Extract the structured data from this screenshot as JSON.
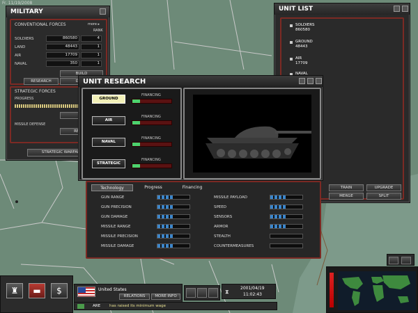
{
  "map": {
    "date_label": "Fr. 11/19/2008"
  },
  "military": {
    "title": "MILITARY",
    "conventional_label": "CONVENTIONAL FORCES",
    "more_label": "more ▸",
    "rank_label": "RANK",
    "rows": [
      {
        "label": "SOLDIERS",
        "value": "860580",
        "rank": "4"
      },
      {
        "label": "LAND",
        "value": "48443",
        "rank": "1"
      },
      {
        "label": "AIR",
        "value": "17709",
        "rank": "1"
      },
      {
        "label": "NAVAL",
        "value": "350",
        "rank": "1"
      }
    ],
    "build_label": "BUILD",
    "research_label": "RESEARCH",
    "design_label": "DESIG",
    "strategic_label": "STRATEGIC FORCES",
    "progress_label": "PROGRESS",
    "build2_label": "BUI",
    "missile_defense_label": "MISSILE DEFENSE",
    "missile_defense_value": "N",
    "research2_label": "RESEAR",
    "strategic_warfare_label": "STRATEGIC WARFARE"
  },
  "unit_list": {
    "title": "UNIT LIST",
    "items": [
      {
        "label": "SOLDIERS",
        "value": "860580"
      },
      {
        "label": "GROUND",
        "value": "48443"
      },
      {
        "label": "AIR",
        "value": "17709"
      },
      {
        "label": "NAVAL",
        "value": ""
      }
    ],
    "train_label": "TRAIN",
    "upgrade_label": "UPGRADE",
    "merge_label": "MERGE",
    "split_label": "SPLIT"
  },
  "research": {
    "title": "UNIT RESEARCH",
    "categories": [
      {
        "label": "GROUND",
        "active": true,
        "financing_label": "FINANCING",
        "financing": 0.2
      },
      {
        "label": "AIR",
        "active": false,
        "financing_label": "FINANCING",
        "financing": 0.2
      },
      {
        "label": "NAVAL",
        "active": false,
        "financing_label": "FINANCING",
        "financing": 0.2
      },
      {
        "label": "STRATEGIC",
        "active": false,
        "financing_label": "FINANCING",
        "financing": 0.2
      }
    ]
  },
  "tech": {
    "tabs": [
      "Technology",
      "Progress",
      "Financing"
    ],
    "left": [
      {
        "name": "GUN RANGE",
        "level": 0.5
      },
      {
        "name": "GUN PRECISION",
        "level": 0.5
      },
      {
        "name": "GUN DAMAGE",
        "level": 0.5
      },
      {
        "name": "MISSILE RANGE",
        "level": 0.5
      },
      {
        "name": "MISSILE PRECISION",
        "level": 0.5
      },
      {
        "name": "MISSILE DAMAGE",
        "level": 0.5
      }
    ],
    "right": [
      {
        "name": "MISSILE PAYLOAD",
        "level": 0.5
      },
      {
        "name": "SPEED",
        "level": 0.5
      },
      {
        "name": "SENSORS",
        "level": 0.5
      },
      {
        "name": "ARMOR",
        "level": 0.5
      },
      {
        "name": "STEALTH",
        "level": 0
      },
      {
        "name": "COUNTERMEASURES",
        "level": 0
      }
    ]
  },
  "bottom": {
    "country": "United States",
    "relations_label": "RELATIONS",
    "more_info_label": "MORE INFO",
    "date": "2001/04/19",
    "time": "11:02:43",
    "news_country": "ARE",
    "news_text": "has raised its minimum wage"
  },
  "colors": {
    "panel_border": "#7c2a24",
    "financing_fill": "#4cd26e",
    "tech_fill": "#3b86cc",
    "active_tab": "#f2f0b8"
  }
}
